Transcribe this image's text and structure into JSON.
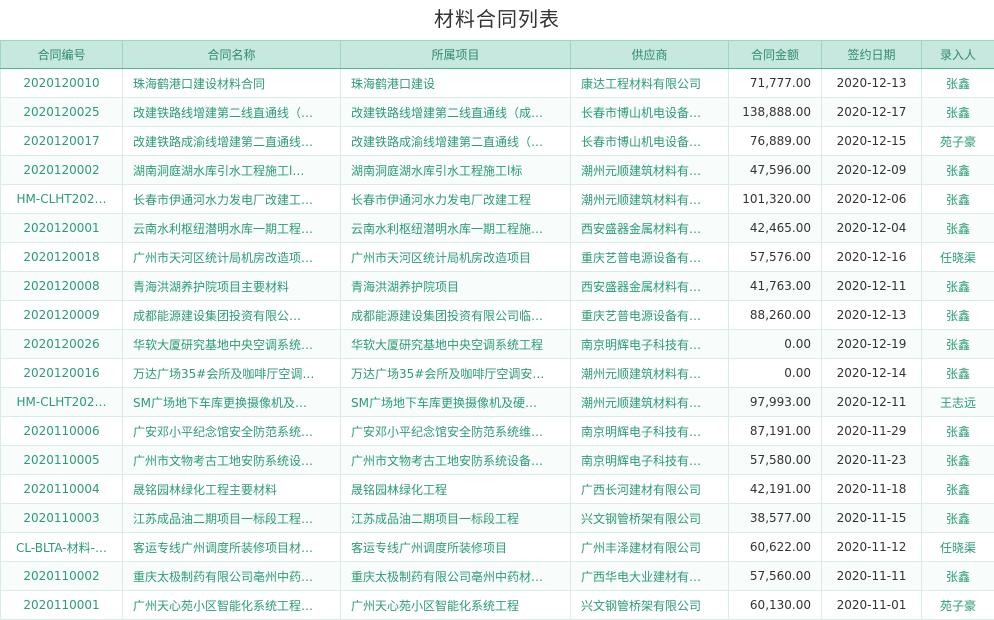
{
  "page_title": "材料合同列表",
  "columns": [
    "合同编号",
    "合同名称",
    "所属项目",
    "供应商",
    "合同金额",
    "签约日期",
    "录入人"
  ],
  "rows": [
    {
      "id": "2020120010",
      "name": "珠海鹤港口建设材料合同",
      "project": "珠海鹤港口建设",
      "supplier": "康达工程材料有限公司",
      "amount": "71,777.00",
      "date": "2020-12-13",
      "user": "张鑫"
    },
    {
      "id": "2020120025",
      "name": "改建铁路线增建第二线直通线（…",
      "project": "改建铁路线增建第二线直通线（成…",
      "supplier": "长春市博山机电设备…",
      "amount": "138,888.00",
      "date": "2020-12-17",
      "user": "张鑫"
    },
    {
      "id": "2020120017",
      "name": "改建铁路成渝线增建第二直通线…",
      "project": "改建铁路成渝线增建第二直通线（…",
      "supplier": "长春市博山机电设备…",
      "amount": "76,889.00",
      "date": "2020-12-15",
      "user": "苑子豪"
    },
    {
      "id": "2020120002",
      "name": "湖南洞庭湖水库引水工程施工l…",
      "project": "湖南洞庭湖水库引水工程施工l标",
      "supplier": "潮州元顺建筑材料有…",
      "amount": "47,596.00",
      "date": "2020-12-09",
      "user": "张鑫"
    },
    {
      "id": "HM-CLHT202…",
      "name": "长春市伊通河水力发电厂改建工…",
      "project": "长春市伊通河水力发电厂改建工程",
      "supplier": "潮州元顺建筑材料有…",
      "amount": "101,320.00",
      "date": "2020-12-06",
      "user": "张鑫"
    },
    {
      "id": "2020120001",
      "name": "云南水利枢纽潜明水库一期工程…",
      "project": "云南水利枢纽潜明水库一期工程施…",
      "supplier": "西安盛器金属材料有…",
      "amount": "42,465.00",
      "date": "2020-12-04",
      "user": "张鑫"
    },
    {
      "id": "2020120018",
      "name": "广州市天河区统计局机房改造项…",
      "project": "广州市天河区统计局机房改造项目",
      "supplier": "重庆艺普电源设备有…",
      "amount": "57,576.00",
      "date": "2020-12-16",
      "user": "任晓渠"
    },
    {
      "id": "2020120008",
      "name": "青海洪湖养护院项目主要材料",
      "project": "青海洪湖养护院项目",
      "supplier": "西安盛器金属材料有…",
      "amount": "41,763.00",
      "date": "2020-12-11",
      "user": "张鑫"
    },
    {
      "id": "2020120009",
      "name": "成都能源建设集团投资有限公…",
      "project": "成都能源建设集团投资有限公司临…",
      "supplier": "重庆艺普电源设备有…",
      "amount": "88,260.00",
      "date": "2020-12-13",
      "user": "张鑫"
    },
    {
      "id": "2020120026",
      "name": "华软大厦研究基地中央空调系统…",
      "project": "华软大厦研究基地中央空调系统工程",
      "supplier": "南京明辉电子科技有…",
      "amount": "0.00",
      "date": "2020-12-19",
      "user": "张鑫"
    },
    {
      "id": "2020120016",
      "name": "万达广场35#会所及咖啡厅空调…",
      "project": "万达广场35#会所及咖啡厅空调安…",
      "supplier": "潮州元顺建筑材料有…",
      "amount": "0.00",
      "date": "2020-12-14",
      "user": "张鑫"
    },
    {
      "id": "HM-CLHT202…",
      "name": "SM广场地下车库更换摄像机及…",
      "project": "SM广场地下车库更换摄像机及硬…",
      "supplier": "潮州元顺建筑材料有…",
      "amount": "97,993.00",
      "date": "2020-12-11",
      "user": "王志远"
    },
    {
      "id": "2020110006",
      "name": "广安邓小平纪念馆安全防范系统…",
      "project": "广安邓小平纪念馆安全防范系统维…",
      "supplier": "南京明辉电子科技有…",
      "amount": "87,191.00",
      "date": "2020-11-29",
      "user": "张鑫"
    },
    {
      "id": "2020110005",
      "name": "广州市文物考古工地安防系统设…",
      "project": "广州市文物考古工地安防系统设备…",
      "supplier": "南京明辉电子科技有…",
      "amount": "57,580.00",
      "date": "2020-11-23",
      "user": "张鑫"
    },
    {
      "id": "2020110004",
      "name": "晟铭园林绿化工程主要材料",
      "project": "晟铭园林绿化工程",
      "supplier": "广西长河建材有限公司",
      "amount": "42,191.00",
      "date": "2020-11-18",
      "user": "张鑫"
    },
    {
      "id": "2020110003",
      "name": "江苏成品油二期项目一标段工程…",
      "project": "江苏成品油二期项目一标段工程",
      "supplier": "兴文钢管桥架有限公司",
      "amount": "38,577.00",
      "date": "2020-11-15",
      "user": "张鑫"
    },
    {
      "id": "CL-BLTA-材料-…",
      "name": "客运专线广州调度所装修项目材…",
      "project": "客运专线广州调度所装修项目",
      "supplier": "广州丰泽建材有限公司",
      "amount": "60,622.00",
      "date": "2020-11-12",
      "user": "任晓渠"
    },
    {
      "id": "2020110002",
      "name": "重庆太极制药有限公司亳州中药…",
      "project": "重庆太极制药有限公司亳州中药材…",
      "supplier": "广西华电大业建材有…",
      "amount": "57,560.00",
      "date": "2020-11-11",
      "user": "张鑫"
    },
    {
      "id": "2020110001",
      "name": "广州天心苑小区智能化系统工程…",
      "project": "广州天心苑小区智能化系统工程",
      "supplier": "兴文钢管桥架有限公司",
      "amount": "60,130.00",
      "date": "2020-11-01",
      "user": "苑子豪"
    }
  ]
}
